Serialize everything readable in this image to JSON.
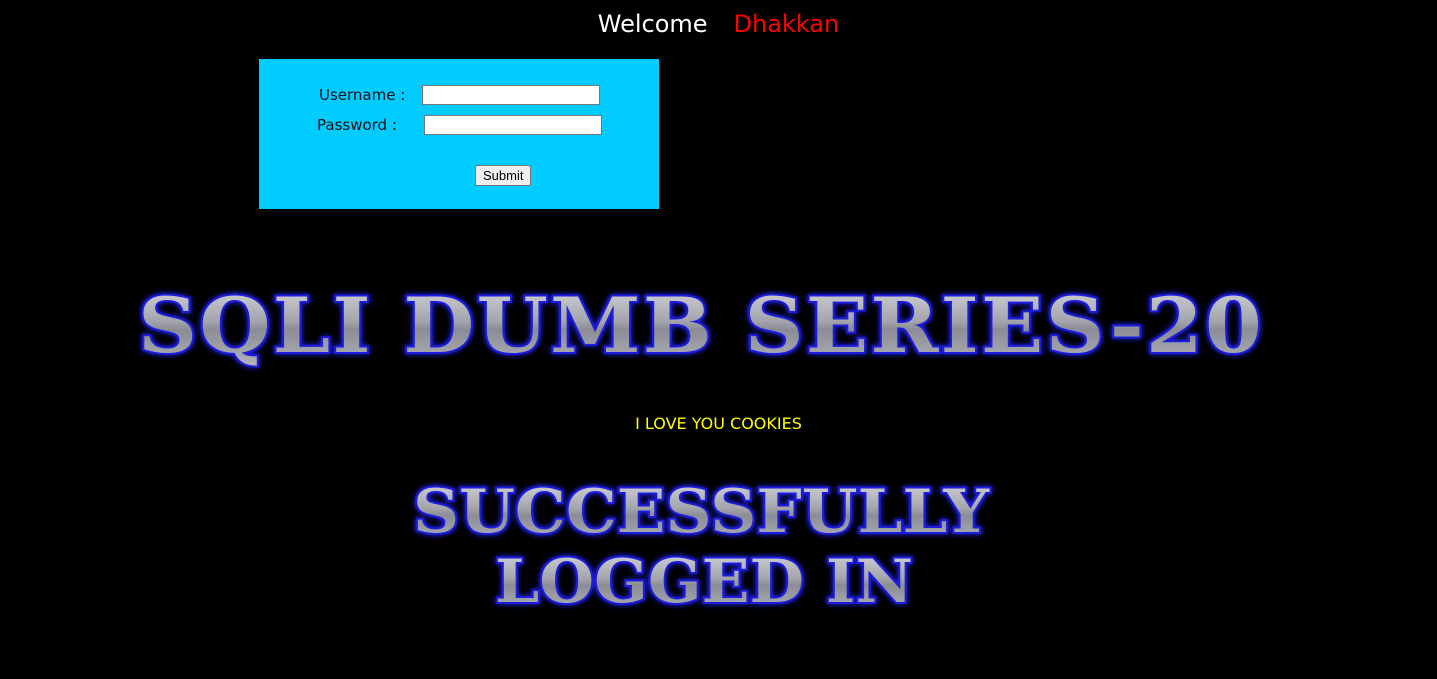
{
  "header": {
    "welcome_label": "Welcome",
    "username": "Dhakkan"
  },
  "login_form": {
    "username_label": "Username :",
    "username_value": "",
    "password_label": "Password :",
    "password_value": "",
    "submit_label": "Submit"
  },
  "banner": {
    "title": "SQLI DUMB SERIES-20"
  },
  "message": {
    "cookie_text": "I LOVE YOU COOKIES"
  },
  "status_banner": {
    "line1": "SUCCESSFULLY",
    "line2": "LOGGED IN"
  },
  "colors": {
    "background": "#000000",
    "form_bg": "#00ccff",
    "welcome_text": "#ffffff",
    "username_text": "#ff0000",
    "cookie_text": "#ffff00",
    "banner_outline": "#1a1adc",
    "banner_fill": "#a8a8b0"
  }
}
